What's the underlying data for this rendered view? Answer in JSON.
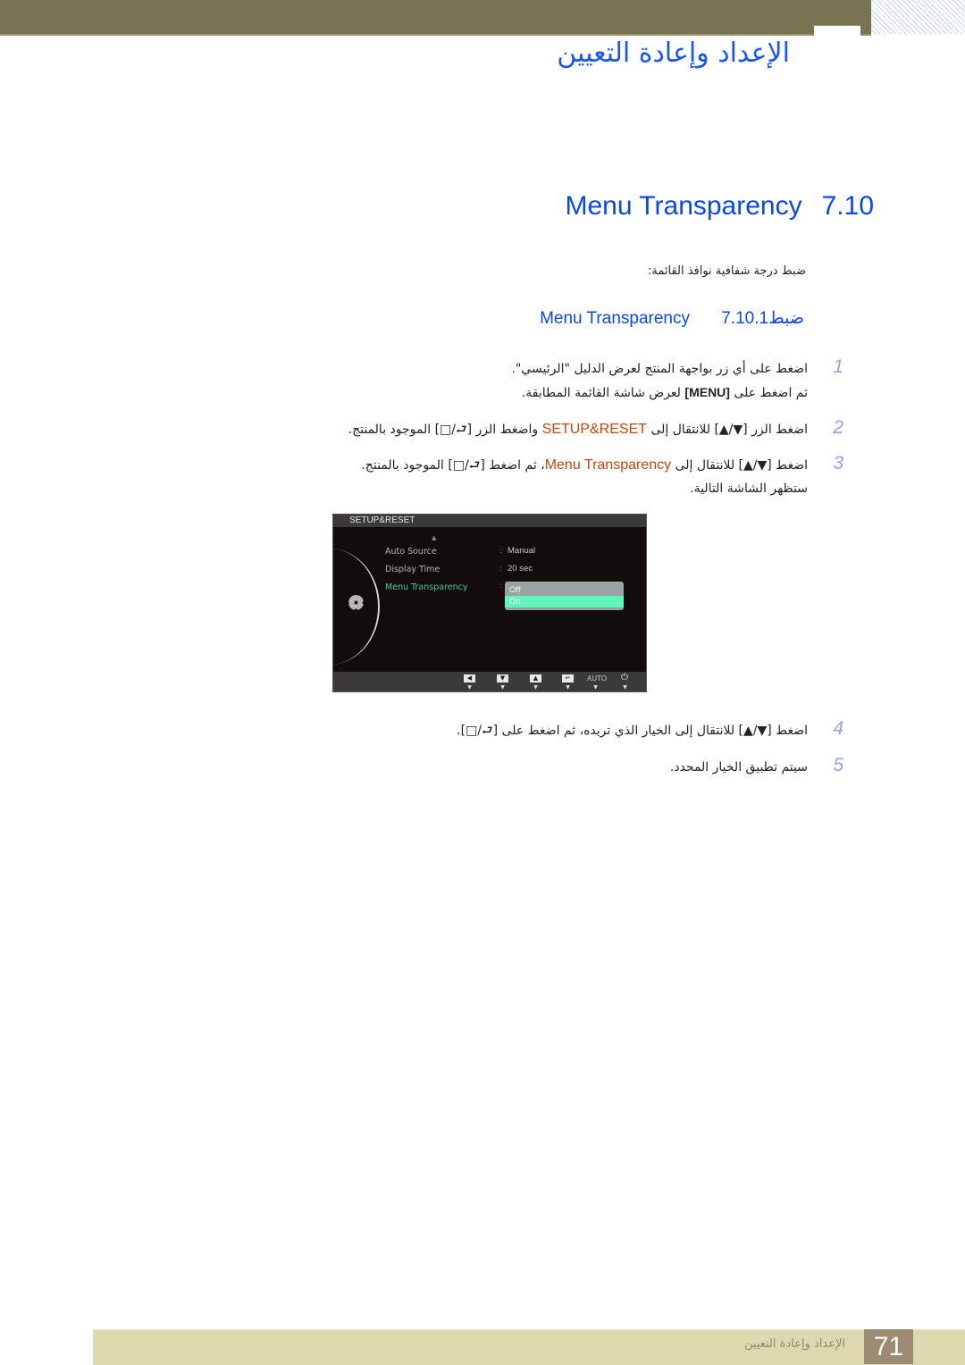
{
  "header": {
    "chapter_title": "الإعداد وإعادة التعيين"
  },
  "section": {
    "number": "7.10",
    "title": "Menu Transparency",
    "intro": "ضبط درجة شفافية نوافذ القائمة:"
  },
  "subsection": {
    "number": "7.10.1",
    "title_ar": "ضبط",
    "title_en": "Menu Transparency"
  },
  "steps": [
    {
      "number": "1",
      "line1": "اضغط على أي زر بواجهة المنتج لعرض الدليل \"الرئيسي\".",
      "line2_pre": "ثم اضغط على ",
      "line2_key": "[MENU]",
      "line2_post": " لعرض شاشة القائمة المطابقة."
    },
    {
      "number": "2",
      "pre": "اضغط الزر [▼/▲] للانتقال إلى ",
      "highlight": "SETUP&RESET",
      "post": " واضغط الزر [⮐/□] الموجود بالمنتج."
    },
    {
      "number": "3",
      "pre": "اضغط [▼/▲] للانتقال إلى ",
      "highlight": "Menu Transparency",
      "post": "، ثم اضغط [⮐/□] الموجود بالمنتج.",
      "line2": "ستظهر الشاشة التالية."
    },
    {
      "number": "4",
      "text": "اضغط [▼/▲] للانتقال إلى الخيار الذي تريده، ثم اضغط على [⮐/□]."
    },
    {
      "number": "5",
      "text": "سيتم تطبيق الخيار المحدد."
    }
  ],
  "osd": {
    "header": "SETUP&RESET",
    "items": [
      {
        "label": "Auto Source",
        "value": "Manual"
      },
      {
        "label": "Display Time",
        "value": "20 sec"
      },
      {
        "label": "Menu Transparency",
        "value": ""
      }
    ],
    "dropdown_options": [
      "Off",
      "On"
    ],
    "selected_option": "On",
    "footer_buttons": [
      "◀",
      "▼",
      "▲",
      "↵",
      "AUTO",
      "⏻"
    ]
  },
  "footer": {
    "chapter_name": "الإعداد وإعادة التعيين",
    "page_number": "71"
  }
}
